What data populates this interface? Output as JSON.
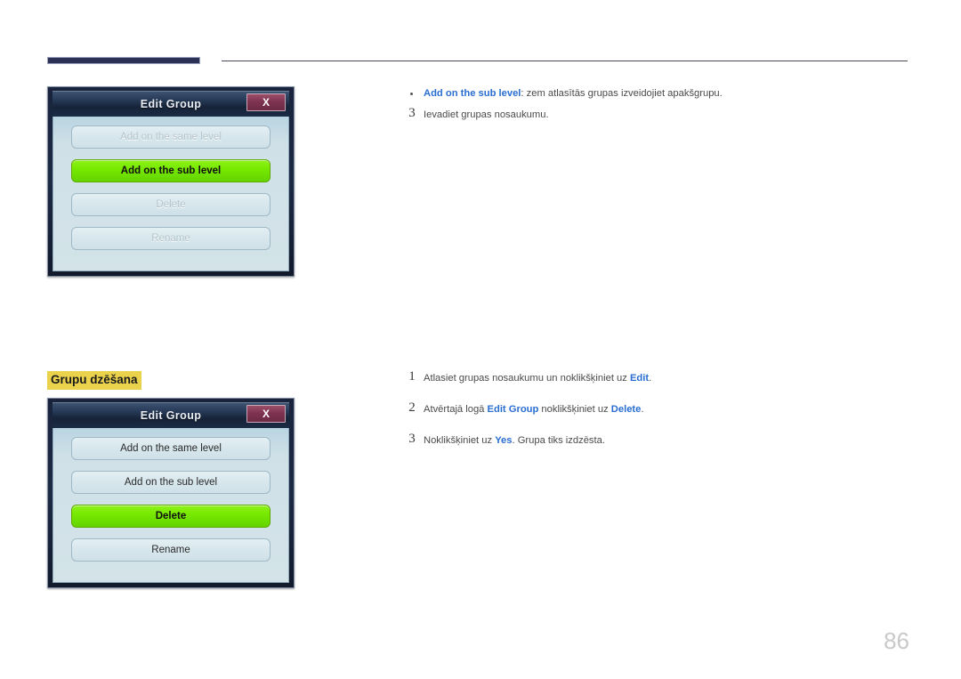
{
  "page": {
    "number": "86"
  },
  "header": {
    "rule_label": "header-rule"
  },
  "dialog_top": {
    "title": "Edit Group",
    "close_label": "X",
    "options": [
      {
        "label": "Add on the same level",
        "state": "disabled"
      },
      {
        "label": "Add on the sub level",
        "state": "selected"
      },
      {
        "label": "Delete",
        "state": "disabled"
      },
      {
        "label": "Rename",
        "state": "disabled"
      }
    ]
  },
  "dialog_bottom": {
    "title": "Edit Group",
    "close_label": "X",
    "options": [
      {
        "label": "Add on the same level",
        "state": "normal"
      },
      {
        "label": "Add on the sub level",
        "state": "normal"
      },
      {
        "label": "Delete",
        "state": "selected"
      },
      {
        "label": "Rename",
        "state": "normal"
      }
    ]
  },
  "top_text": {
    "bullet": {
      "term": "Add on the sub level",
      "rest": ": zem atlasītās grupas izveidojiet apakšgrupu."
    },
    "step": {
      "number": "3",
      "text": "Ievadiet grupas nosaukumu."
    }
  },
  "section": {
    "heading": "Grupu dzēšana"
  },
  "steps": [
    {
      "number": "1",
      "pre": "Atlasiet grupas nosaukumu un noklikšķiniet uz ",
      "link": "Edit",
      "post": "."
    },
    {
      "number": "2",
      "pre": "Atvērtajā logā ",
      "link": "Edit Group",
      "mid": " noklikšķiniet uz ",
      "link2": "Delete",
      "post": "."
    },
    {
      "number": "3",
      "pre": "Noklikšķiniet uz ",
      "link": "Yes",
      "post": ". Grupa tiks izdzēsta."
    }
  ],
  "colors": {
    "accent_blue": "#2a6ed2",
    "highlight_yellow": "#ead24c",
    "selected_green": "#77e900",
    "titlebar_navy": "#1b2c46",
    "close_maroon": "#7e3350",
    "page_number_gray": "#c9c9c9"
  }
}
